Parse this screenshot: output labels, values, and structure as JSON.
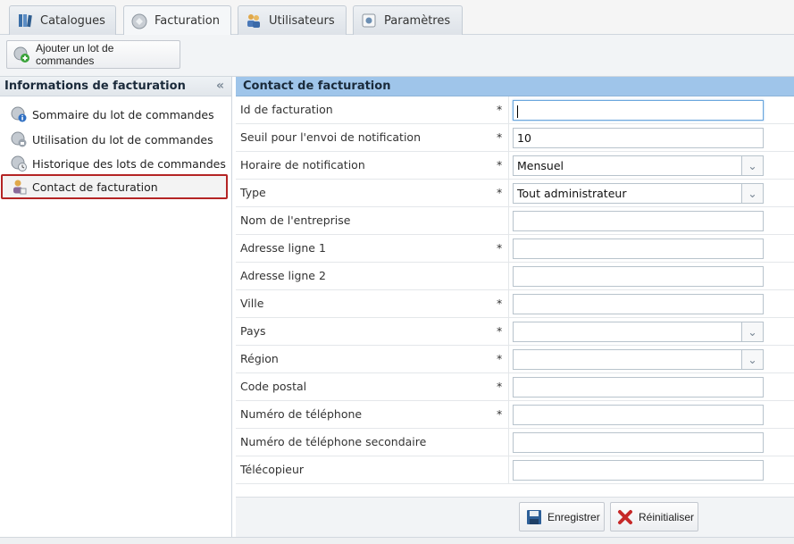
{
  "tabs": [
    {
      "label": "Catalogues",
      "icon": "catalog-icon",
      "active": false
    },
    {
      "label": "Facturation",
      "icon": "billing-icon",
      "active": true
    },
    {
      "label": "Utilisateurs",
      "icon": "users-icon",
      "active": false
    },
    {
      "label": "Paramètres",
      "icon": "settings-icon",
      "active": false
    }
  ],
  "toolbar": {
    "add_batch_label": "Ajouter un lot de commandes"
  },
  "sidebar": {
    "title": "Informations de facturation",
    "collapse_glyph": "«",
    "items": [
      {
        "label": "Sommaire du lot de commandes",
        "icon": "info-icon"
      },
      {
        "label": "Utilisation du lot de commandes",
        "icon": "usage-icon"
      },
      {
        "label": "Historique des lots de commandes",
        "icon": "history-icon"
      },
      {
        "label": "Contact de facturation",
        "icon": "contact-icon",
        "selected": true
      }
    ]
  },
  "form": {
    "title": "Contact de facturation",
    "required_mark": "*",
    "fields": [
      {
        "label": "Id de facturation",
        "required": true,
        "type": "text",
        "value": "",
        "focused": true
      },
      {
        "label": "Seuil pour l'envoi de notification",
        "required": true,
        "type": "text",
        "value": "10"
      },
      {
        "label": "Horaire de notification",
        "required": true,
        "type": "select",
        "value": "Mensuel"
      },
      {
        "label": "Type",
        "required": true,
        "type": "select",
        "value": "Tout administrateur"
      },
      {
        "label": "Nom de l'entreprise",
        "required": false,
        "type": "text",
        "value": ""
      },
      {
        "label": "Adresse ligne 1",
        "required": true,
        "type": "text",
        "value": ""
      },
      {
        "label": "Adresse ligne 2",
        "required": false,
        "type": "text",
        "value": ""
      },
      {
        "label": "Ville",
        "required": true,
        "type": "text",
        "value": ""
      },
      {
        "label": "Pays",
        "required": true,
        "type": "select",
        "value": ""
      },
      {
        "label": "Région",
        "required": true,
        "type": "select",
        "value": ""
      },
      {
        "label": "Code postal",
        "required": true,
        "type": "text",
        "value": ""
      },
      {
        "label": "Numéro de téléphone",
        "required": true,
        "type": "text",
        "value": ""
      },
      {
        "label": "Numéro de téléphone secondaire",
        "required": false,
        "type": "text",
        "value": ""
      },
      {
        "label": "Télécopieur",
        "required": false,
        "type": "text",
        "value": ""
      }
    ],
    "save_label": "Enregistrer",
    "reset_label": "Réinitialiser"
  },
  "colors": {
    "header_blue": "#9fc5ea",
    "selection_border": "#b42424",
    "reset_red": "#c62828"
  }
}
